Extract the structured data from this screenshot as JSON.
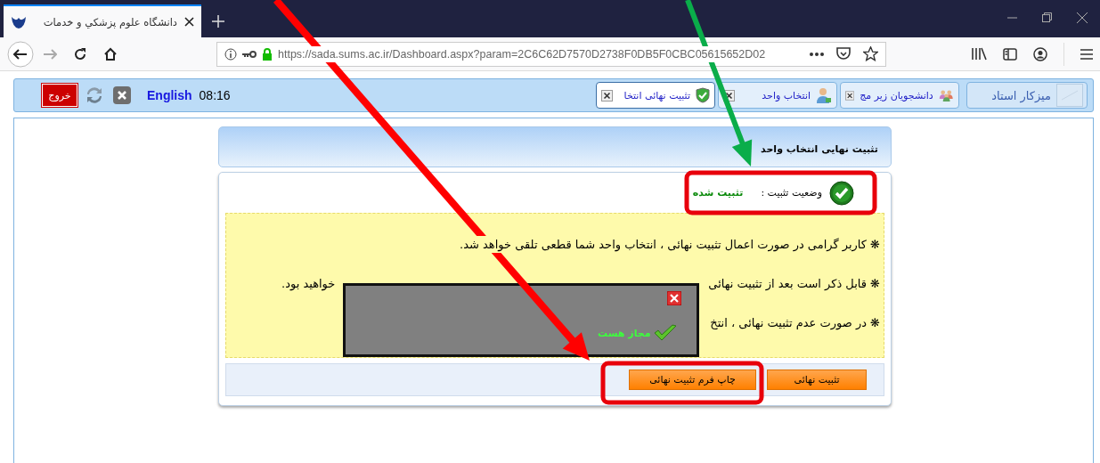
{
  "browser": {
    "tab_title": "دانشگاه علوم پزشكي و خدمات",
    "url": "https://sada.sums.ac.ir/Dashboard.aspx?param=2C6C62D7570D2738F0DB5F0CBC05615652D02"
  },
  "header": {
    "exit_label": "خروج",
    "language": "English",
    "time": "08:16",
    "home_label": "میزکار استاد",
    "tabs": [
      {
        "label": "دانشجویان زیر مج",
        "selected": false
      },
      {
        "label": "انتخاب واحد",
        "selected": false
      },
      {
        "label": "تثبیت نهائی انتخا",
        "selected": true
      }
    ]
  },
  "card": {
    "title": "تثبیت نهایی انتخاب واحد",
    "status_label": "وضعیت تثبیت :",
    "status_value": "تثبیت شده",
    "notes": [
      {
        "bullet": "❋",
        "parts": [
          "کاربر گرامی در صورت اعمال تثبیت نهائی ، انتخاب واحد شما قطعی تلقی خواهد شد."
        ]
      },
      {
        "bullet": "❋",
        "parts": [
          "قابل ذکر است بعد از تثبیت نهائی",
          "خواهید بود."
        ]
      },
      {
        "bullet": "❋",
        "parts": [
          "در صورت عدم تثبیت نهائی ، انتخ"
        ]
      }
    ],
    "buttons": [
      "تثبیت نهائی",
      "چاپ فرم تثبیت نهائی"
    ],
    "popup": {
      "message": "مجاز هست"
    }
  }
}
